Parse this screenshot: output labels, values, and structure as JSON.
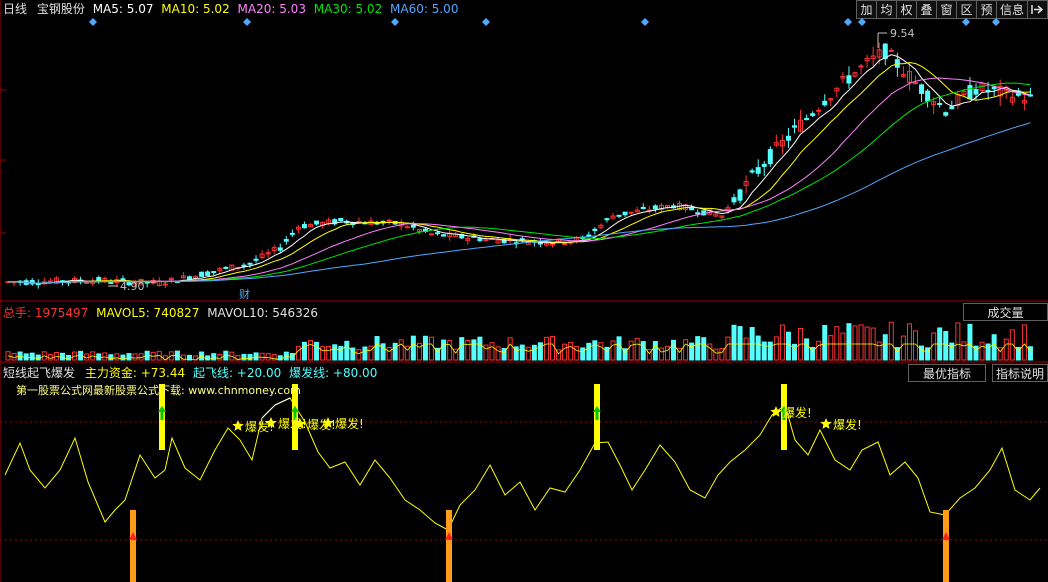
{
  "colors": {
    "background": "#000000",
    "up": "#ff3232",
    "down": "#54ffff",
    "ma5": "#ffffff",
    "ma10": "#ffff00",
    "ma20": "#ff80ff",
    "ma30": "#00e600",
    "ma60": "#4fa8ff",
    "signal_bar": "#ffff00",
    "bottom_bar": "#ff9a1a"
  },
  "header": {
    "period": "日线",
    "stock_name": "宝钢股份",
    "ma5": "MA5: 5.07",
    "ma10": "MA10: 5.02",
    "ma20": "MA20: 5.03",
    "ma30": "MA30: 5.02",
    "ma60": "MA60: 5.00"
  },
  "toolbar": {
    "fq": "加",
    "jun": "均",
    "quan": "权",
    "die": "叠",
    "chuang": "窗",
    "qu": "区",
    "yu": "预",
    "xinxi": "信息",
    "exit_icon": "exit-icon"
  },
  "price_chart": {
    "high_label": "9.54",
    "low_label": "4.90",
    "cai_marker": "财"
  },
  "volume": {
    "total": "总手: 1975497",
    "mavol5": "MAVOL5: 740827",
    "mavol10": "MAVOL10: 546326",
    "button": "成交量"
  },
  "indicator": {
    "name": "短线起飞爆发",
    "main_fund": "主力资金: +73.44",
    "qifei": "起飞线: +20.00",
    "baofa": "爆发线: +80.00",
    "best_button": "最优指标",
    "explain_button": "指标说明",
    "watermark": "第一股票公式网最新股票公式下载: www.chnmoney.com",
    "burst_label": "爆发!"
  }
}
